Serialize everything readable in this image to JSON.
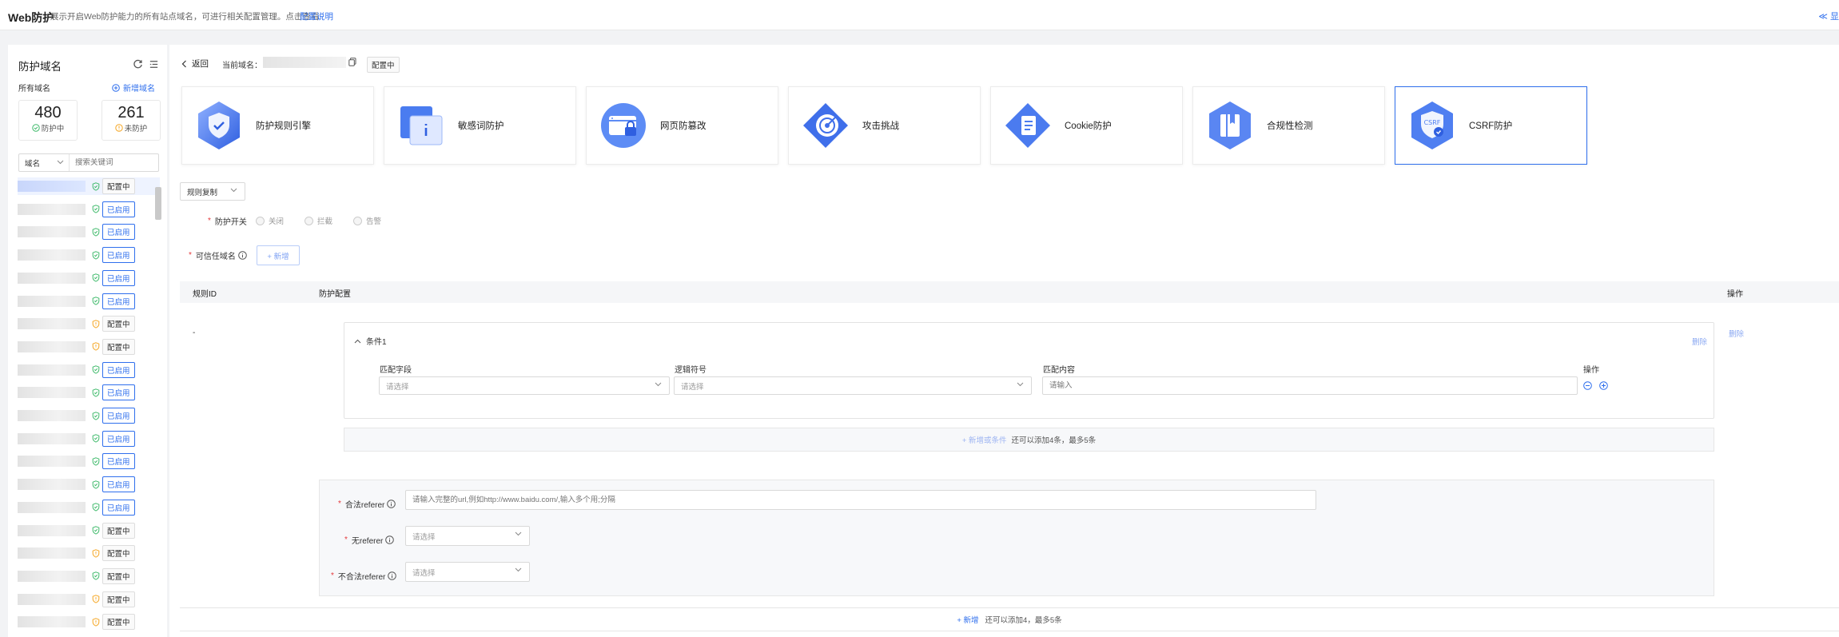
{
  "topbar": {
    "title": "Web防护",
    "desc": "展示开启Web防护能力的所有站点域名，可进行相关配置管理。点击查看",
    "link": "配置说明",
    "right_action": "≪ 显"
  },
  "sidebar": {
    "title": "防护域名",
    "all_domains": "所有域名",
    "add_domain": "新增域名",
    "stats": [
      {
        "value": "480",
        "label": "防护中"
      },
      {
        "value": "261",
        "label": "未防护"
      }
    ],
    "filter_field": "域名",
    "search_placeholder": "搜索关键词",
    "rows": [
      {
        "status": "ok",
        "tag": "配置中",
        "tag_type": "cfg"
      },
      {
        "status": "ok",
        "tag": "已启用",
        "tag_type": "on"
      },
      {
        "status": "ok",
        "tag": "已启用",
        "tag_type": "on"
      },
      {
        "status": "ok",
        "tag": "已启用",
        "tag_type": "on"
      },
      {
        "status": "ok",
        "tag": "已启用",
        "tag_type": "on"
      },
      {
        "status": "ok",
        "tag": "已启用",
        "tag_type": "on"
      },
      {
        "status": "warn",
        "tag": "配置中",
        "tag_type": "cfg"
      },
      {
        "status": "warn",
        "tag": "配置中",
        "tag_type": "cfg"
      },
      {
        "status": "ok",
        "tag": "已启用",
        "tag_type": "on"
      },
      {
        "status": "ok",
        "tag": "已启用",
        "tag_type": "on"
      },
      {
        "status": "ok",
        "tag": "已启用",
        "tag_type": "on"
      },
      {
        "status": "ok",
        "tag": "已启用",
        "tag_type": "on"
      },
      {
        "status": "ok",
        "tag": "已启用",
        "tag_type": "on"
      },
      {
        "status": "ok",
        "tag": "已启用",
        "tag_type": "on"
      },
      {
        "status": "ok",
        "tag": "已启用",
        "tag_type": "on"
      },
      {
        "status": "ok",
        "tag": "配置中",
        "tag_type": "cfg"
      },
      {
        "status": "warn",
        "tag": "配置中",
        "tag_type": "cfg"
      },
      {
        "status": "ok",
        "tag": "配置中",
        "tag_type": "cfg"
      },
      {
        "status": "warn",
        "tag": "配置中",
        "tag_type": "cfg"
      },
      {
        "status": "warn",
        "tag": "配置中",
        "tag_type": "cfg"
      }
    ]
  },
  "header": {
    "back": "返回",
    "current_domain_label": "当前域名：",
    "status_tag": "配置中"
  },
  "modules": [
    {
      "label": "防护规则引擎",
      "icon": "shield-check-icon"
    },
    {
      "label": "敏感词防护",
      "icon": "document-info-icon"
    },
    {
      "label": "网页防篡改",
      "icon": "webpage-lock-icon"
    },
    {
      "label": "攻击挑战",
      "icon": "target-icon"
    },
    {
      "label": "Cookie防护",
      "icon": "cookie-doc-icon"
    },
    {
      "label": "合规性检测",
      "icon": "book-icon"
    },
    {
      "label": "CSRF防护",
      "icon": "csrf-shield-icon"
    }
  ],
  "rule_copy": "规则复制",
  "switch": {
    "label": "防护开关",
    "options": [
      "关闭",
      "拦截",
      "告警"
    ]
  },
  "trusted_domain": {
    "label": "可信任域名",
    "add": "+ 新增"
  },
  "table": {
    "columns": [
      "规则ID",
      "防护配置",
      "操作"
    ],
    "row_id": "-",
    "row_delete": "删除"
  },
  "condition": {
    "title": "条件1",
    "delete": "删除",
    "columns": [
      "匹配字段",
      "逻辑符号",
      "匹配内容",
      "操作"
    ],
    "field_placeholder": "请选择",
    "logic_placeholder": "请选择",
    "content_placeholder": "请输入",
    "add_label": "+ 新增或条件",
    "add_hint": "还可以添加4条，最多5条"
  },
  "referer": {
    "legal_label": "合法referer",
    "legal_placeholder": "请输入完整的url,例如http://www.baidu.com/,输入多个用;分隔",
    "none_label": "无referer",
    "none_placeholder": "请选择",
    "illegal_label": "不合法referer",
    "illegal_placeholder": "请选择"
  },
  "footer": {
    "add": "+ 新增",
    "hint": "还可以添加4，最多5条"
  },
  "colors": {
    "accent": "#2f6fed",
    "ok": "#3fba6b",
    "warn": "#f5a623",
    "required": "#e4393c"
  }
}
